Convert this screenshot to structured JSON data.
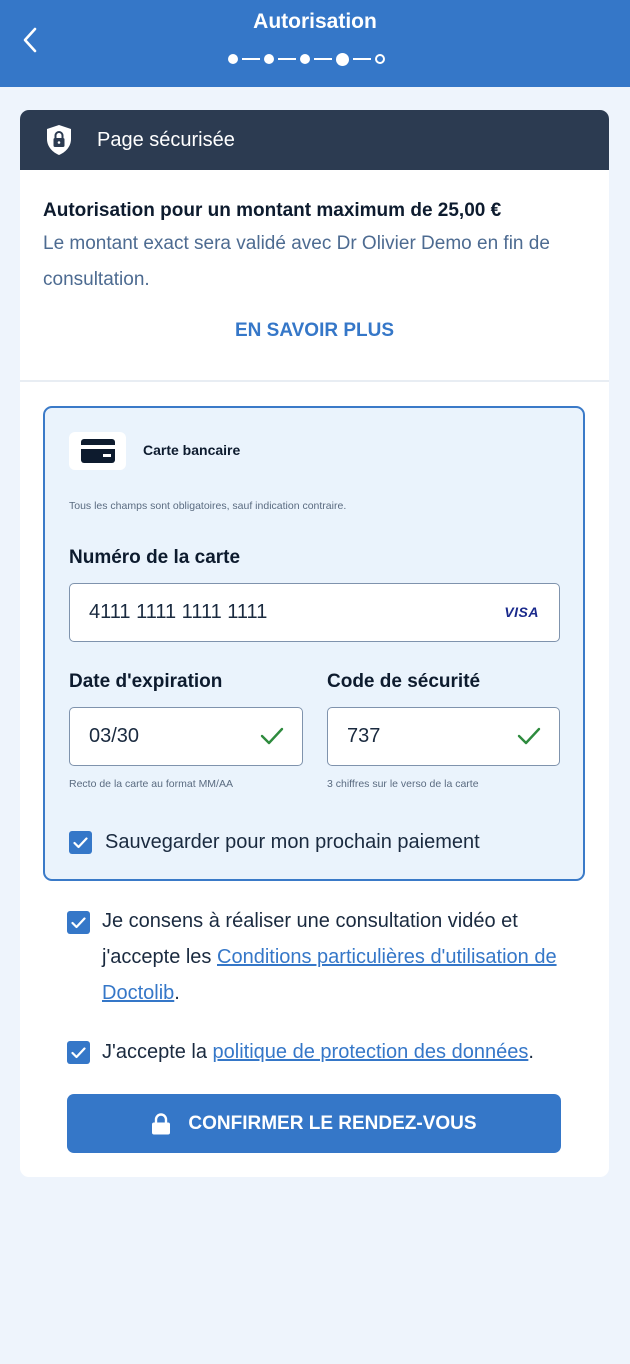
{
  "header": {
    "title": "Autorisation",
    "back_icon": "chevron-left-icon",
    "steps_total": 5,
    "current_step": 4
  },
  "secure": {
    "label": "Page sécurisée",
    "icon": "shield-lock-icon"
  },
  "authorization": {
    "title": "Autorisation pour un montant maximum de 25,00 €",
    "description": "Le montant exact sera validé avec Dr Olivier Demo en fin de consultation.",
    "learn_more": "EN SAVOIR PLUS"
  },
  "payment": {
    "method_label": "Carte bancaire",
    "method_icon": "credit-card-icon",
    "required_note": "Tous les champs sont obligatoires, sauf indication contraire.",
    "card_number_label": "Numéro de la carte",
    "card_number_value": "4111 1111 1111 1111",
    "card_brand": "VISA",
    "expiry_label": "Date d'expiration",
    "expiry_value": "03/30",
    "expiry_hint": "Recto de la carte au format MM/AA",
    "cvc_label": "Code de sécurité",
    "cvc_value": "737",
    "cvc_hint": "3 chiffres sur le verso de la carte",
    "save_label": "Sauvegarder pour mon prochain paiement",
    "save_checked": true
  },
  "consents": {
    "video_text_1": "Je consens à réaliser une consultation vidéo et j'accepte les ",
    "video_link": "Conditions particulières d'utilisation de Doctolib",
    "video_text_2": ".",
    "privacy_text_1": "J'accepte la ",
    "privacy_link": "politique de protection des données",
    "privacy_text_2": "."
  },
  "confirm_button": "CONFIRMER LE RENDEZ-VOUS",
  "colors": {
    "primary": "#3577c8",
    "secure_bar": "#2c3b51",
    "success_check": "#2e8b3e",
    "background": "#eef4fc"
  }
}
